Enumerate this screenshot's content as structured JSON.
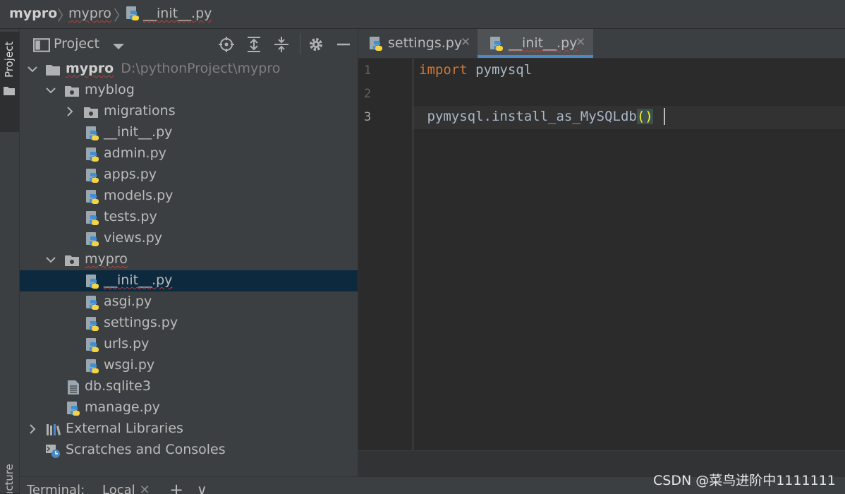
{
  "breadcrumb": {
    "items": [
      "mypro",
      "mypro",
      "__init__.py"
    ]
  },
  "sidebar_tabs": {
    "project": "Project",
    "structure": "Structure"
  },
  "project_panel": {
    "title": "Project",
    "tree": [
      {
        "label": "mypro",
        "path": "D:\\pythonProject\\mypro",
        "type": "folder",
        "expanded": true
      },
      {
        "label": "myblog",
        "type": "folder",
        "expanded": true
      },
      {
        "label": "migrations",
        "type": "folder",
        "expanded": false
      },
      {
        "label": "__init__.py",
        "type": "python"
      },
      {
        "label": "admin.py",
        "type": "python"
      },
      {
        "label": "apps.py",
        "type": "python"
      },
      {
        "label": "models.py",
        "type": "python"
      },
      {
        "label": "tests.py",
        "type": "python"
      },
      {
        "label": "views.py",
        "type": "python"
      },
      {
        "label": "mypro",
        "type": "folder",
        "expanded": true
      },
      {
        "label": "__init__.py",
        "type": "python",
        "selected": true
      },
      {
        "label": "asgi.py",
        "type": "python"
      },
      {
        "label": "settings.py",
        "type": "python"
      },
      {
        "label": "urls.py",
        "type": "python"
      },
      {
        "label": "wsgi.py",
        "type": "python"
      },
      {
        "label": "db.sqlite3",
        "type": "file"
      },
      {
        "label": "manage.py",
        "type": "python"
      },
      {
        "label": "External Libraries",
        "type": "libraries",
        "expanded": false
      },
      {
        "label": "Scratches and Consoles",
        "type": "scratches"
      }
    ]
  },
  "editor": {
    "tabs": [
      {
        "label": "settings.py",
        "active": false
      },
      {
        "label": "__init__.py",
        "active": true
      }
    ],
    "line_numbers": [
      "1",
      "2",
      "3"
    ],
    "code": {
      "line1_keyword": "import",
      "line1_rest": " pymysql",
      "line2": "",
      "line3_prefix": " pymysql.install_as_MySQLdb",
      "line3_parens": "()"
    }
  },
  "bottom_bar": {
    "terminal_label": "Terminal:",
    "local_tab": "Local",
    "add_symbol": "+",
    "dropdown_symbol": "∨"
  },
  "watermark": "CSDN @菜鸟进阶中1111111",
  "colors": {
    "keyword": "#cc7832",
    "code_text": "#a9b7c6",
    "selection": "#0d293e",
    "tab_underline": "#4a88c7"
  }
}
